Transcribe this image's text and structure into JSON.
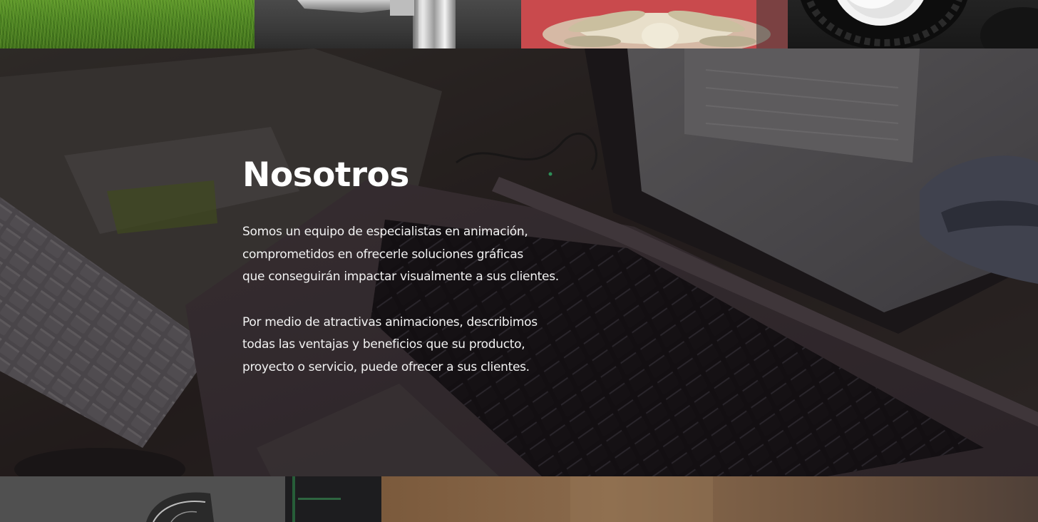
{
  "gallery_top": {
    "tiles": [
      {
        "name": "grass-image"
      },
      {
        "name": "metal-part-image"
      },
      {
        "name": "skeleton-render-image"
      },
      {
        "name": "tire-render-image"
      }
    ]
  },
  "about": {
    "title": "Nosotros",
    "paragraph_1": [
      "Somos un equipo de especialistas en animación,",
      "comprometidos en ofrecerle soluciones gráficas",
      "que conseguirán impactar visualmente a sus clientes."
    ],
    "paragraph_2": [
      "Por medio de atractivas animaciones, describimos",
      "todas las ventajas y beneficios que su producto,",
      "proyecto o servicio, puede ofrecer a sus clientes."
    ]
  },
  "colors": {
    "title": "#ffffff",
    "body_text": "#f2f2f2",
    "overlay": "#141010"
  }
}
